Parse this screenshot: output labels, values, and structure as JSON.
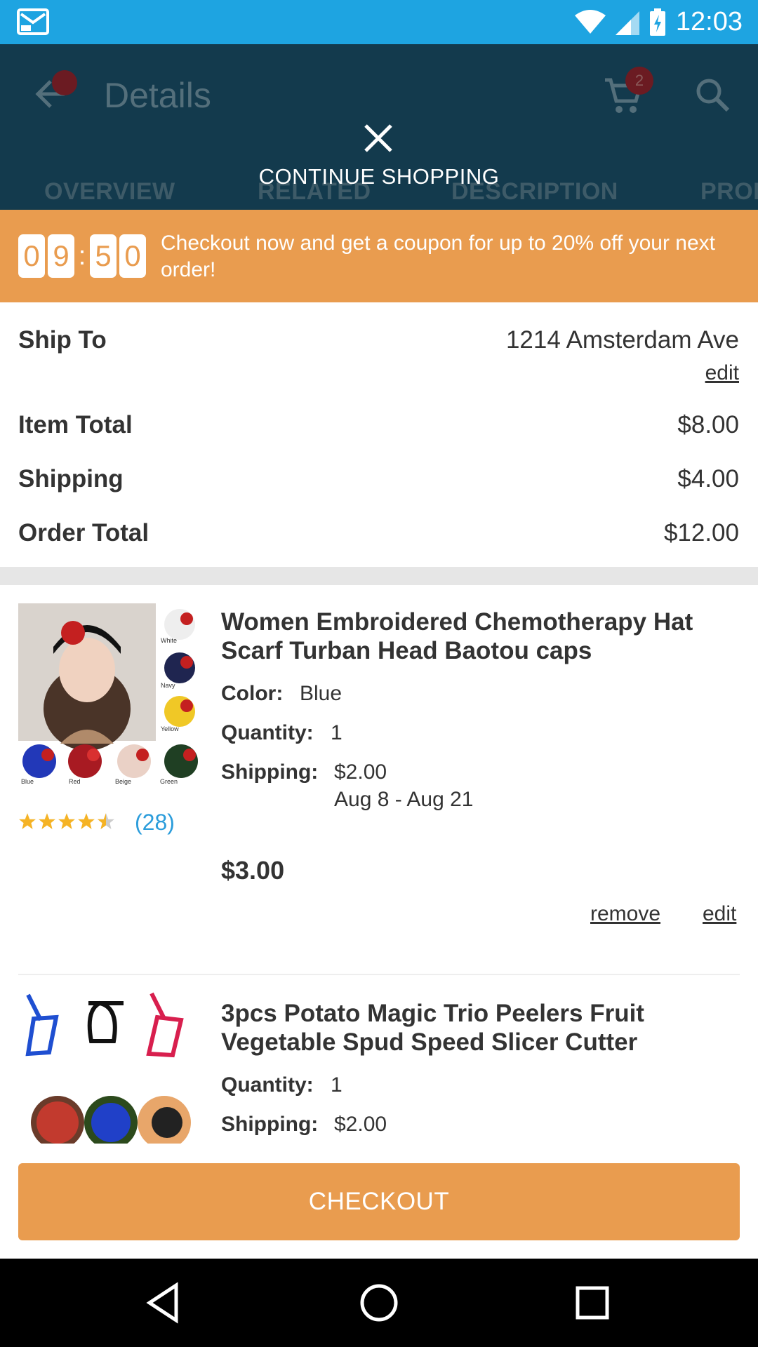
{
  "status_bar": {
    "time": "12:03"
  },
  "app_bar": {
    "title": "Details",
    "cart_count": "2"
  },
  "tabs": [
    "OVERVIEW",
    "RELATED",
    "DESCRIPTION",
    "PROD"
  ],
  "overlay": {
    "close_label": "CONTINUE SHOPPING"
  },
  "promo": {
    "timer_digits": [
      "0",
      "9",
      "5",
      "0"
    ],
    "message": "Checkout now and get a coupon for up to 20% off your next order!"
  },
  "summary": {
    "ship_to_label": "Ship To",
    "ship_to_value": "1214 Amsterdam Ave",
    "edit_label": "edit",
    "item_total_label": "Item Total",
    "item_total_value": "$8.00",
    "shipping_label": "Shipping",
    "shipping_value": "$4.00",
    "order_total_label": "Order Total",
    "order_total_value": "$12.00"
  },
  "items": [
    {
      "title": "Women Embroidered Chemotherapy Hat Scarf Turban Head Baotou caps",
      "color_label": "Color:",
      "color_value": "Blue",
      "quantity_label": "Quantity:",
      "quantity_value": "1",
      "shipping_label": "Shipping:",
      "shipping_value": "$2.00",
      "shipping_dates": "Aug 8 - Aug 21",
      "rating": 4.5,
      "rating_count": "(28)",
      "price": "$3.00",
      "remove_label": "remove",
      "edit_label": "edit",
      "swatch_labels": [
        "White",
        "Navy",
        "Yellow",
        "Blue",
        "Red",
        "Beige",
        "Green"
      ]
    },
    {
      "title": "3pcs Potato  Magic Trio Peelers Fruit Vegetable Spud Speed Slicer Cutter",
      "quantity_label": "Quantity:",
      "quantity_value": "1",
      "shipping_label": "Shipping:",
      "shipping_value": "$2.00"
    }
  ],
  "checkout_label": "CHECKOUT",
  "colors": {
    "status_bar": "#1ea4e1",
    "app_bar": "#133a4d",
    "accent": "#e99c4f",
    "link": "#2c9ddb"
  }
}
